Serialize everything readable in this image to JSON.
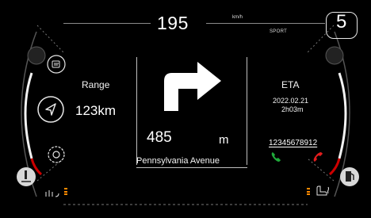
{
  "speed": {
    "value": "195",
    "unit": "km/h"
  },
  "drive_mode": "SPORT",
  "gear": "5",
  "range": {
    "label": "Range",
    "value": "123km"
  },
  "navigation": {
    "maneuver_icon": "turn-right-arrow-icon",
    "distance": "485",
    "distance_unit": "m",
    "street": "Pennsylvania Avenue"
  },
  "eta": {
    "label": "ETA",
    "date": "2022.02.21",
    "duration": "2h03m"
  },
  "call": {
    "number": "12345678912"
  },
  "colors": {
    "accent_orange": "#ff8a00",
    "accept_green": "#1faa3a",
    "decline_red": "#e11d1d"
  }
}
